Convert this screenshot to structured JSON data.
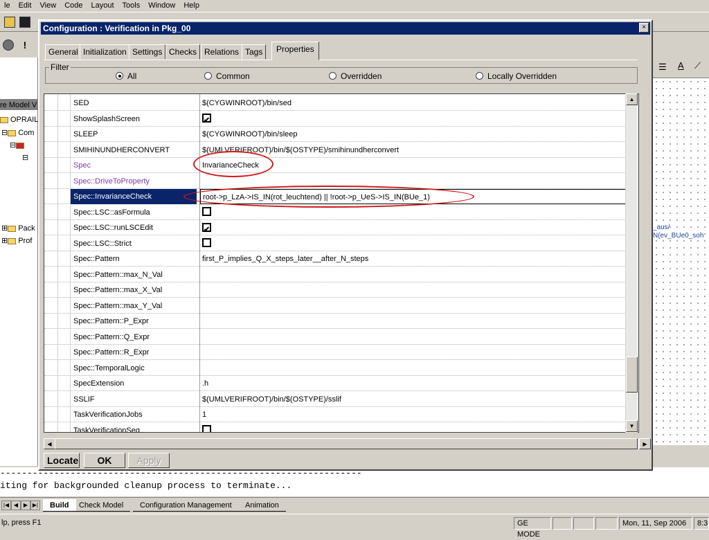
{
  "app": {
    "menu": [
      "le",
      "Edit",
      "View",
      "Code",
      "Layout",
      "Tools",
      "Window",
      "Help"
    ],
    "left_tree": {
      "header": "re Model V",
      "items": [
        "OPRAILI",
        "Com",
        "Pack",
        "Prof"
      ]
    },
    "right_pane": {
      "labels": [
        "_aus/",
        "N(ev_BUe0_soh"
      ]
    },
    "output": {
      "lines": [
        "-------------------------------------------------------------------",
        "iting for backgrounded cleanup process to terminate..."
      ]
    },
    "bottom_tabs": [
      "Build",
      "Check Model",
      "Configuration Management",
      "Animation"
    ],
    "status": {
      "help": "lp, press F1",
      "mode": "GE MODE",
      "date": "Mon, 11, Sep 2006",
      "time": "8:3"
    }
  },
  "dialog": {
    "title": "Configuration : Verification in Pkg_00",
    "close_glyph": "×",
    "tabs": [
      "General",
      "Initialization",
      "Settings",
      "Checks",
      "Relations",
      "Tags",
      "Properties"
    ],
    "active_tab": "Properties",
    "filter": {
      "label": "Filter",
      "options": [
        "All",
        "Common",
        "Overridden",
        "Locally Overridden"
      ],
      "selected": "All"
    },
    "properties": [
      {
        "name": "SED",
        "value": "$(CYGWINROOT)/bin/sed"
      },
      {
        "name": "ShowSplashScreen",
        "value": "",
        "checkbox": true,
        "checked": true
      },
      {
        "name": "SLEEP",
        "value": "$(CYGWINROOT)/bin/sleep"
      },
      {
        "name": "SMIHINUNDHERCONVERT",
        "value": "$(UMLVERIFROOT)/bin/$(OSTYPE)/smihinundherconvert"
      },
      {
        "name": "Spec",
        "value": "InvarianceCheck"
      },
      {
        "name": "Spec::DriveToProperty",
        "value": ""
      },
      {
        "name": "Spec::InvarianceCheck",
        "value": "root->p_LzA->IS_IN(rot_leuchtend) || !root->p_UeS->IS_IN(BUe_1)"
      },
      {
        "name": "Spec::LSC::asFormula",
        "value": "",
        "checkbox": true,
        "checked": false
      },
      {
        "name": "Spec::LSC::runLSCEdit",
        "value": "",
        "checkbox": true,
        "checked": true
      },
      {
        "name": "Spec::LSC::Strict",
        "value": "",
        "checkbox": true,
        "checked": false
      },
      {
        "name": "Spec::Pattern",
        "value": "first_P_implies_Q_X_steps_later__after_N_steps"
      },
      {
        "name": "Spec::Pattern::max_N_Val",
        "value": ""
      },
      {
        "name": "Spec::Pattern::max_X_Val",
        "value": ""
      },
      {
        "name": "Spec::Pattern::max_Y_Val",
        "value": ""
      },
      {
        "name": "Spec::Pattern::P_Expr",
        "value": ""
      },
      {
        "name": "Spec::Pattern::Q_Expr",
        "value": ""
      },
      {
        "name": "Spec::Pattern::R_Expr",
        "value": ""
      },
      {
        "name": "Spec::TemporalLogic",
        "value": ""
      },
      {
        "name": "SpecExtension",
        "value": ".h"
      },
      {
        "name": "SSLIF",
        "value": "$(UMLVERIFROOT)/bin/$(OSTYPE)/sslif"
      },
      {
        "name": "TaskVerificationJobs",
        "value": "1"
      },
      {
        "name": "TaskVerificationSeq",
        "value": "",
        "checkbox": true,
        "checked": false
      }
    ],
    "selected_property": "Spec::InvarianceCheck",
    "buttons": {
      "locate": "Locate",
      "ok": "OK",
      "apply": "Apply"
    }
  },
  "colors": {
    "title_bar": "#0a246a",
    "selection": "#0a246a",
    "spec_text": "#7a3aa8",
    "annotation": "#d01818",
    "face": "#d4d0c8"
  }
}
